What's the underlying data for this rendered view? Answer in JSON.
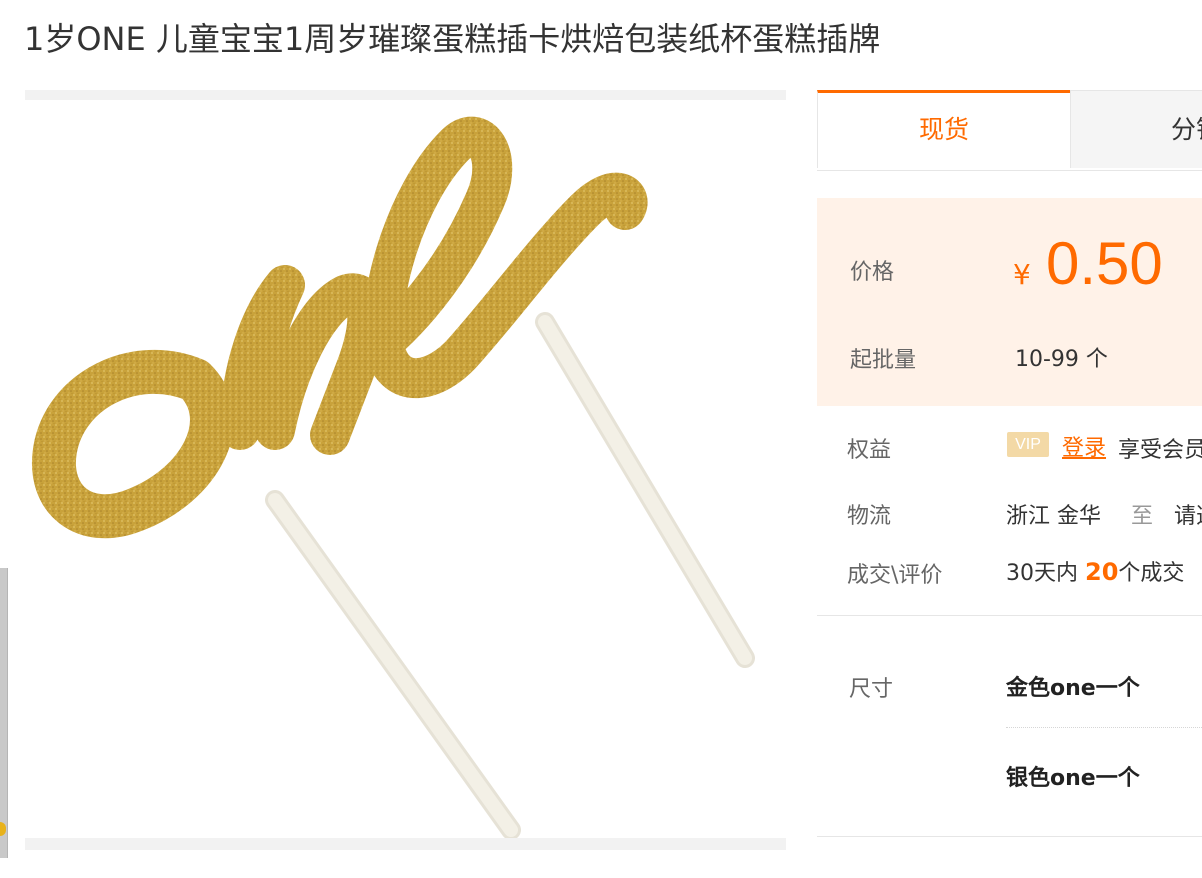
{
  "product": {
    "title": "1岁ONE 儿童宝宝1周岁璀璨蛋糕插卡烘焙包装纸杯蛋糕插牌",
    "image_alt": "one"
  },
  "tabs": [
    {
      "label": "现货",
      "active": true
    },
    {
      "label": "分销",
      "active": false
    }
  ],
  "price": {
    "label": "价格",
    "currency_symbol": "¥",
    "value": "0.50",
    "min_order_label": "起批量",
    "min_order_value": "10-99 个"
  },
  "benefits": {
    "label": "权益",
    "vip_badge": "VIP",
    "login_link": "登录",
    "text": "享受会员"
  },
  "logistics": {
    "label": "物流",
    "origin": "浙江 金华",
    "to": "至",
    "destination": "请选择"
  },
  "deals": {
    "label": "成交\\评价",
    "prefix": "30天内",
    "count": "20",
    "suffix": "个成交"
  },
  "size": {
    "label": "尺寸",
    "options": [
      "金色one一个",
      "银色one一个"
    ]
  },
  "colors": {
    "accent": "#ff6a00",
    "price_bg": "#fff2e8",
    "gold": "#c9a23b"
  }
}
